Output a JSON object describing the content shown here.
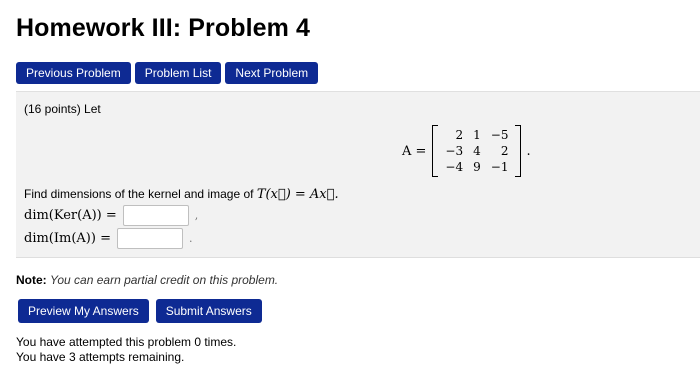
{
  "page": {
    "title": "Homework III: Problem 4"
  },
  "nav": {
    "previous": "Previous Problem",
    "list": "Problem List",
    "next": "Next Problem"
  },
  "problem": {
    "points": "(16 points) Let",
    "matrix_name": "A =",
    "matrix": [
      [
        "2",
        "1",
        "−5"
      ],
      [
        "−3",
        "4",
        "2"
      ],
      [
        "−4",
        "9",
        "−1"
      ]
    ],
    "matrix_end": ".",
    "find_text": "Find dimensions of the kernel and image of ",
    "find_math": "T(x⃗) = Ax⃗.",
    "kernel_label": "dim(Ker(A)) =",
    "kernel_value": "",
    "kernel_punct": ",",
    "image_label": "dim(Im(A)) =",
    "image_value": "",
    "image_punct": "."
  },
  "note": {
    "label": "Note:",
    "text": "You can earn partial credit on this problem."
  },
  "actions": {
    "preview": "Preview My Answers",
    "submit": "Submit Answers"
  },
  "attempts": {
    "line1": "You have attempted this problem 0 times.",
    "line2": "You have 3 attempts remaining."
  }
}
